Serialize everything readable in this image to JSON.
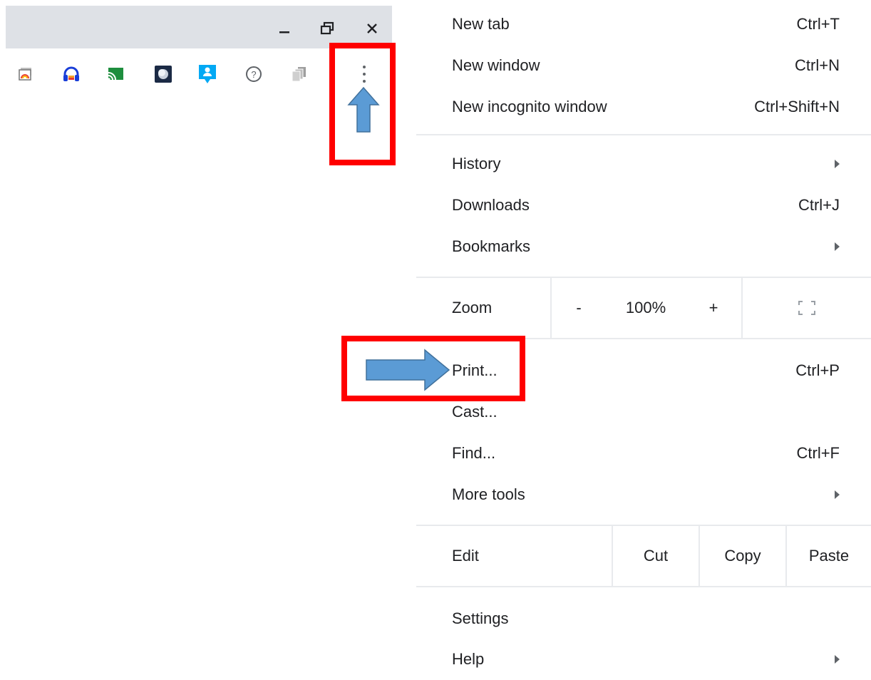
{
  "toolbar": {
    "window_controls": [
      "minimize-icon",
      "restore-icon",
      "close-icon"
    ],
    "extensions": [
      {
        "icon": "stack-window-icon"
      },
      {
        "icon": "headphones-icon"
      },
      {
        "icon": "cast-icon"
      },
      {
        "icon": "moon-icon"
      },
      {
        "icon": "person-chat-icon"
      },
      {
        "icon": "help-icon"
      },
      {
        "icon": "copy-pages-icon"
      }
    ],
    "menu_icon": "more-vertical-icon"
  },
  "menu": {
    "new_tab": {
      "label": "New tab",
      "shortcut": "Ctrl+T"
    },
    "new_window": {
      "label": "New window",
      "shortcut": "Ctrl+N"
    },
    "new_incognito": {
      "label": "New incognito window",
      "shortcut": "Ctrl+Shift+N"
    },
    "history": {
      "label": "History"
    },
    "downloads": {
      "label": "Downloads",
      "shortcut": "Ctrl+J"
    },
    "bookmarks": {
      "label": "Bookmarks"
    },
    "zoom": {
      "label": "Zoom",
      "minus": "-",
      "value": "100%",
      "plus": "+"
    },
    "print": {
      "label": "Print...",
      "shortcut": "Ctrl+P"
    },
    "cast": {
      "label": "Cast..."
    },
    "find": {
      "label": "Find...",
      "shortcut": "Ctrl+F"
    },
    "more_tools": {
      "label": "More tools"
    },
    "edit": {
      "label": "Edit",
      "cut": "Cut",
      "copy": "Copy",
      "paste": "Paste"
    },
    "settings": {
      "label": "Settings"
    },
    "help": {
      "label": "Help"
    }
  },
  "colors": {
    "highlight": "#ff0000",
    "annotation_arrow": "#5b9bd5",
    "titlebar": "#dee1e6"
  }
}
